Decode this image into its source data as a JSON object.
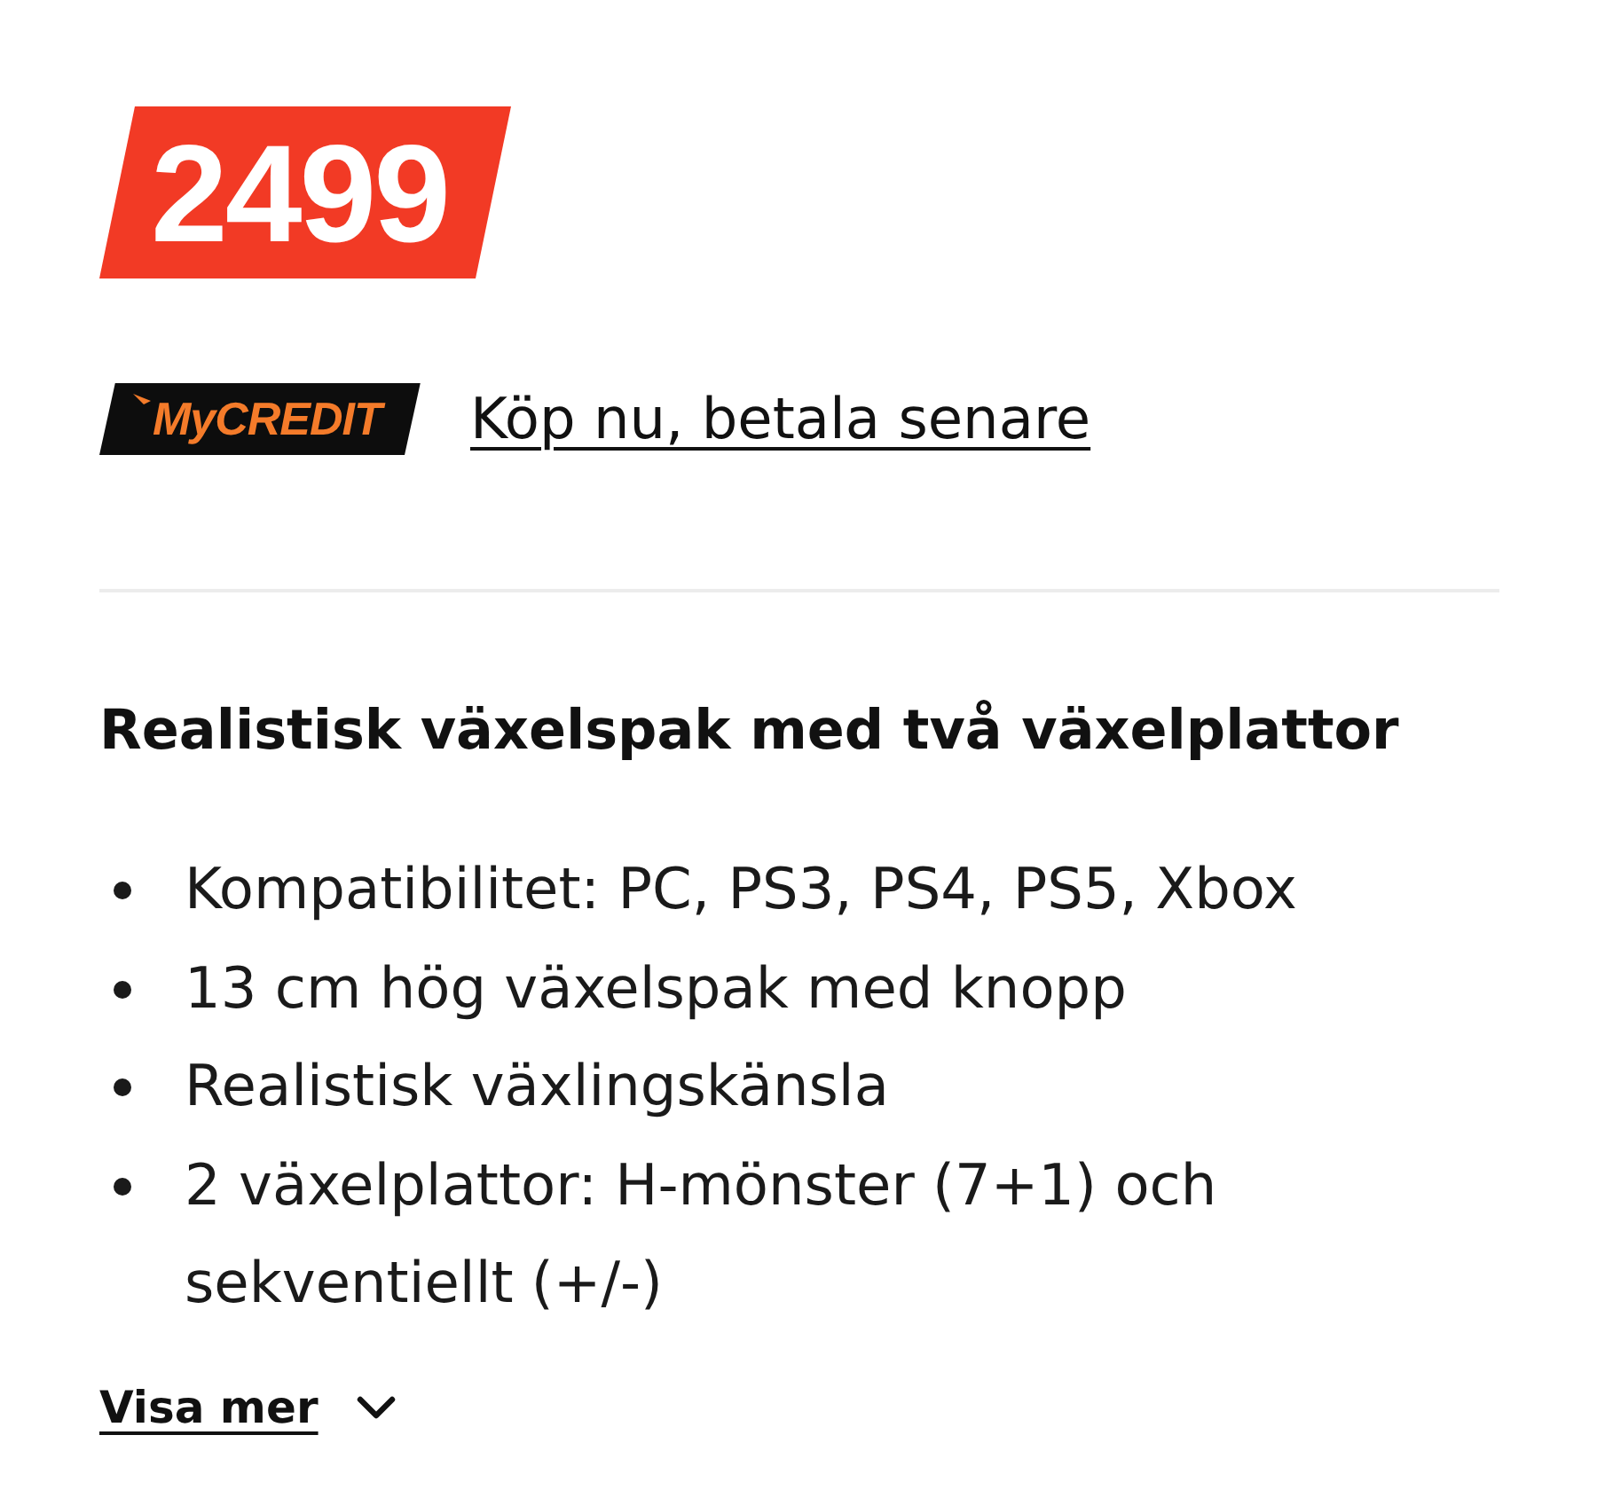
{
  "price_badge": {
    "text": "2499"
  },
  "credit": {
    "logo_text": "MyCREDIT",
    "link": "Köp nu, betala senare"
  },
  "features": {
    "heading": "Realistisk växelspak med två växelplattor",
    "bullets": [
      "Kompatibilitet: PC, PS3, PS4, PS5, Xbox",
      "13 cm hög växelspak med knopp",
      "Realistisk växlingskänsla",
      "2 växelplattor: H-mönster (7+1) och sekventiellt (+/-)"
    ]
  },
  "show_more": {
    "label": "Visa mer",
    "expanded": false
  }
}
